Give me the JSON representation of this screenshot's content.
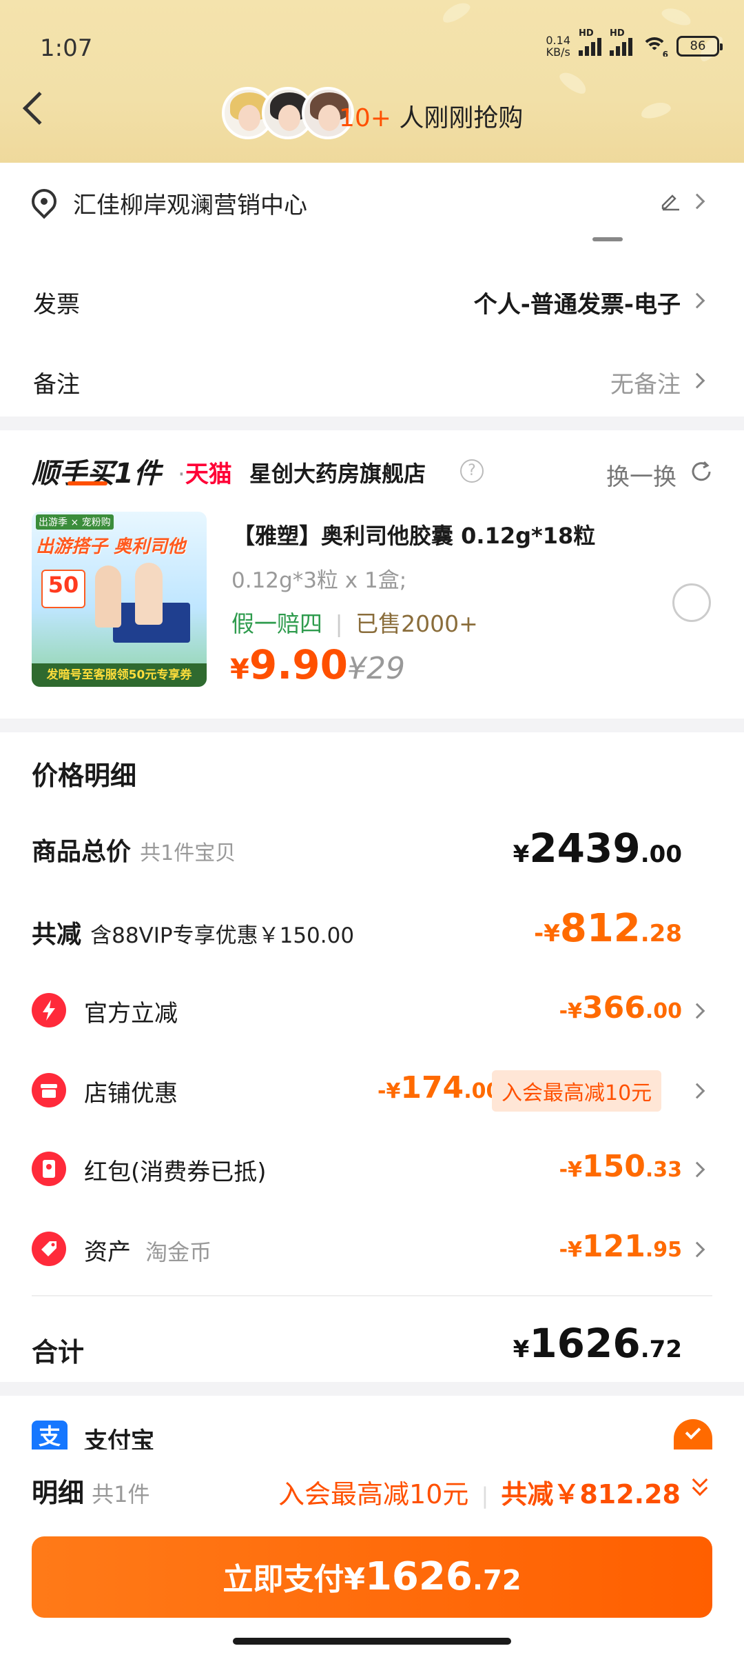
{
  "status_bar": {
    "time": "1:07",
    "net_speed_value": "0.14",
    "net_speed_unit": "KB/s",
    "signal_label": "HD",
    "wifi_label": "6",
    "battery": "86"
  },
  "header": {
    "buyers_count": "10+",
    "buyers_text": " 人刚刚抢购"
  },
  "address": {
    "text": "汇佳柳岸观澜营销中心"
  },
  "invoice": {
    "label": "发票",
    "value": "个人-普通发票-电子"
  },
  "remark": {
    "label": "备注",
    "value": "无备注"
  },
  "addon": {
    "brand_text": "顺手买1件",
    "tmall_label": "天猫",
    "store_name": "星创大药房旗舰店",
    "swap_label": "换一换",
    "product": {
      "title": "【雅塑】奥利司他胶囊 0.12g*18粒",
      "spec": "0.12g*3粒 x 1盒;",
      "tag_guarantee": "假一赔四",
      "tag_sold": "已售2000+",
      "price_symbol": "¥",
      "price": "9.90",
      "original_price": "¥29",
      "image_top_text": "出游季 × 宠粉购",
      "image_title": "出游搭子 奥利司他",
      "image_coupon": "50",
      "image_bottom_text": "发暗号至客服领50元专享券"
    }
  },
  "price_detail": {
    "title": "价格明细",
    "total": {
      "label": "商品总价",
      "sub": "共1件宝贝",
      "symbol": "¥",
      "int": "2439",
      "dec": ".00"
    },
    "discount": {
      "label": "共减",
      "sub": "含88VIP专享优惠￥150.00",
      "prefix": "-¥",
      "int": "812",
      "dec": ".28"
    },
    "items": [
      {
        "label": "官方立减",
        "sub": "",
        "prefix": "-¥",
        "int": "366",
        "dec": ".00",
        "pill": ""
      },
      {
        "label": "店铺优惠",
        "sub": "",
        "prefix": "-¥",
        "int": "174",
        "dec": ".00",
        "pill": "入会最高减10元"
      },
      {
        "label": "红包(消费券已抵)",
        "sub": "",
        "prefix": "-¥",
        "int": "150",
        "dec": ".33",
        "pill": ""
      },
      {
        "label": "资产",
        "sub": "淘金币",
        "prefix": "-¥",
        "int": "121",
        "dec": ".95",
        "pill": ""
      }
    ],
    "sum": {
      "label": "合计",
      "symbol": "¥",
      "int": "1626",
      "dec": ".72"
    }
  },
  "payment": {
    "method": "支付宝"
  },
  "footer": {
    "detail_label": "明细",
    "detail_count": "共1件",
    "member_offer": "入会最高减10元",
    "total_discount": "共减￥812.28",
    "pay_button_text": "立即支付",
    "pay_symbol": "¥",
    "pay_int": "1626",
    "pay_dec": ".72"
  },
  "colors": {
    "accent": "#ff5000",
    "header_bg": "#f2e0a8",
    "green_tag": "#2e9b4d"
  }
}
